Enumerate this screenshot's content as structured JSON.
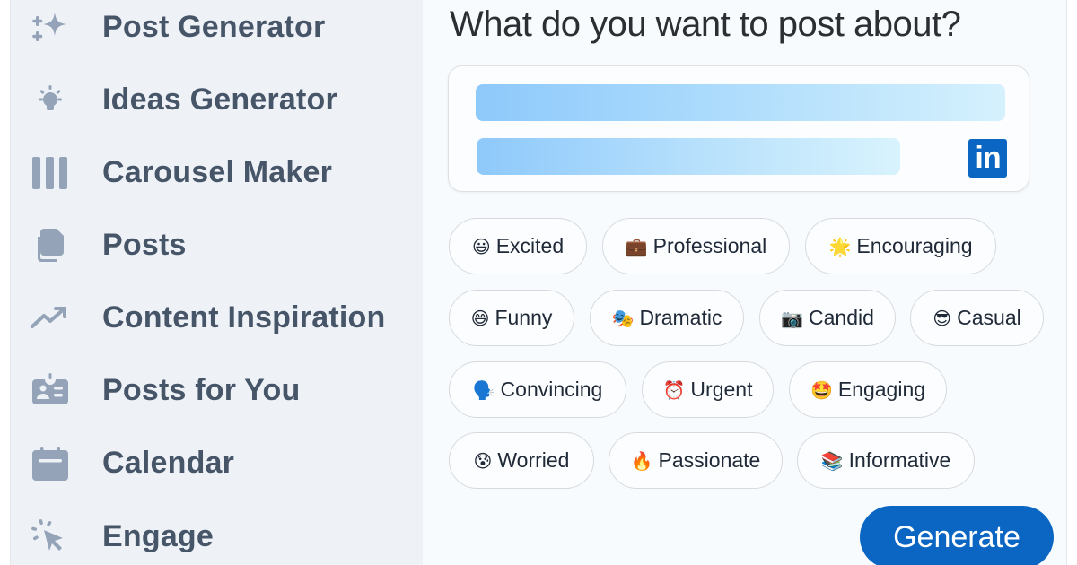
{
  "sidebar": {
    "items": [
      {
        "label": "Post Generator",
        "icon": "sparkles-icon"
      },
      {
        "label": "Ideas Generator",
        "icon": "lightbulb-icon"
      },
      {
        "label": "Carousel Maker",
        "icon": "columns-icon"
      },
      {
        "label": "Posts",
        "icon": "documents-icon"
      },
      {
        "label": "Content Inspiration",
        "icon": "trending-up-icon"
      },
      {
        "label": "Posts for You",
        "icon": "id-badge-icon"
      },
      {
        "label": "Calendar",
        "icon": "calendar-icon"
      },
      {
        "label": "Engage",
        "icon": "cursor-click-icon"
      }
    ]
  },
  "main": {
    "title": "What do you want to post about?",
    "prompt_box": {
      "logo_text": "in",
      "logo_icon": "linkedin-icon"
    },
    "tones": [
      {
        "emoji": "😃",
        "label": "Excited"
      },
      {
        "emoji": "💼",
        "label": "Professional"
      },
      {
        "emoji": "🌟",
        "label": "Encouraging"
      },
      {
        "emoji": "😄",
        "label": "Funny"
      },
      {
        "emoji": "🎭",
        "label": "Dramatic"
      },
      {
        "emoji": "📷",
        "label": "Candid"
      },
      {
        "emoji": "😎",
        "label": "Casual"
      },
      {
        "emoji": "🗣️",
        "label": "Convincing"
      },
      {
        "emoji": "⏰",
        "label": "Urgent"
      },
      {
        "emoji": "🤩",
        "label": "Engaging"
      },
      {
        "emoji": "😰",
        "label": "Worried"
      },
      {
        "emoji": "🔥",
        "label": "Passionate"
      },
      {
        "emoji": "📚",
        "label": "Informative"
      }
    ],
    "generate_label": "Generate"
  },
  "colors": {
    "accent": "#0a66c2",
    "sidebar_bg": "#eef2f7",
    "sidebar_text": "#475569",
    "icon": "#94a3b8"
  }
}
